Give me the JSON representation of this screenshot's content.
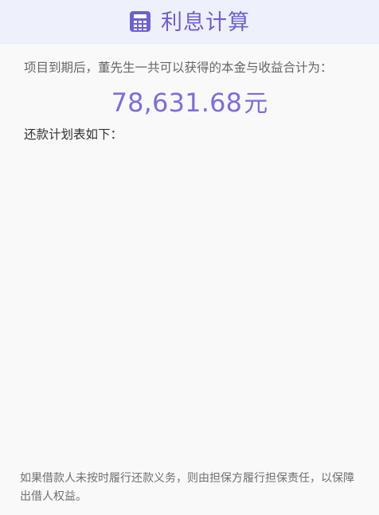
{
  "header": {
    "title": "利息计算",
    "icon": "calculator-icon",
    "accent_color": "#6d5fd6"
  },
  "summary": {
    "text": "项目到期后，董先生一共可以获得的本金与收益合计为：",
    "amount_value": "78,631.68",
    "amount_unit": "元",
    "amount_color": "#7a6ee0"
  },
  "plan": {
    "label": "还款计划表如下："
  },
  "footer": {
    "note": "如果借款人未按时履行还款义务，则由担保方履行担保责任，以保障出借人权益。"
  }
}
